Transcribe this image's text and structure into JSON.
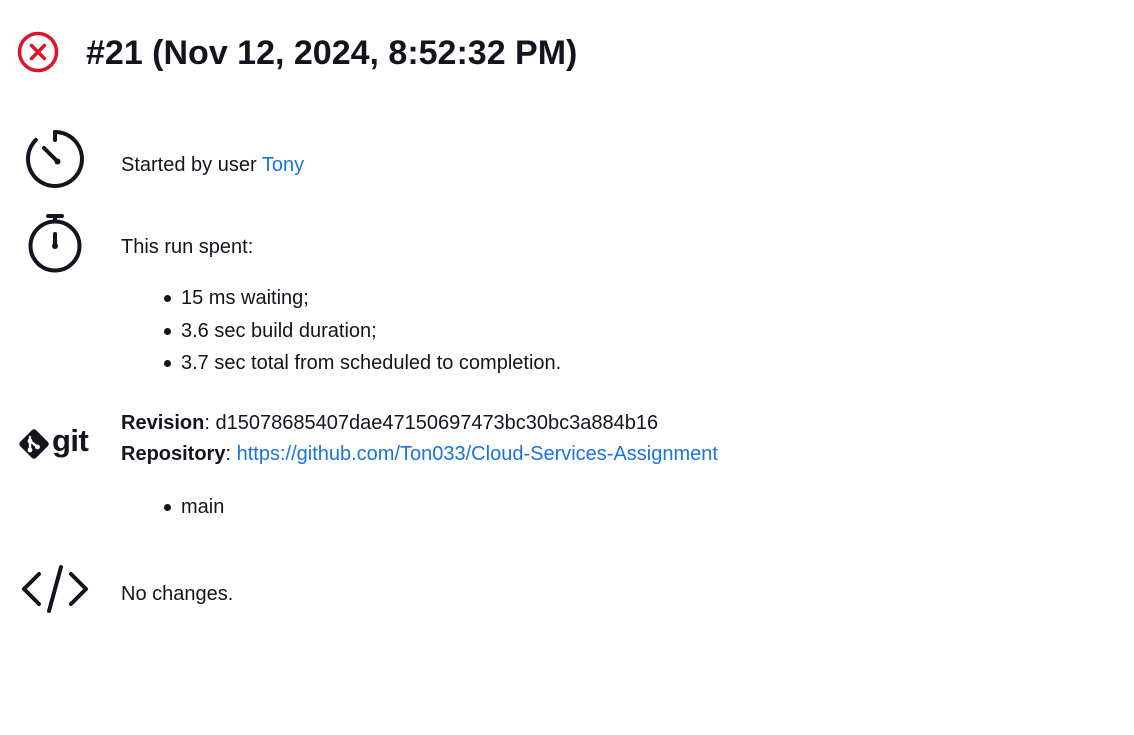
{
  "header": {
    "status": "failed",
    "title": "#21 (Nov 12, 2024, 8:52:32 PM)"
  },
  "started": {
    "prefix": "Started by user ",
    "user": "Tony",
    "icon": "timer-icon"
  },
  "timing": {
    "label": "This run spent:",
    "icon": "stopwatch-icon",
    "items": [
      "15 ms waiting;",
      "3.6 sec build duration;",
      "3.7 sec total from scheduled to completion."
    ]
  },
  "scm": {
    "icon": "git-logo-icon",
    "logo_text": "git",
    "revision_label": "Revision",
    "revision_value": "d15078685407dae47150697473bc30bc3a884b16",
    "repository_label": "Repository",
    "repository_url": "https://github.com/Ton033/Cloud-Services-Assignment",
    "branches": [
      "main"
    ]
  },
  "changes": {
    "icon": "code-icon",
    "text": "No changes."
  },
  "colors": {
    "error": "#e0112b",
    "text": "#14141f",
    "link": "#1a73d9"
  }
}
